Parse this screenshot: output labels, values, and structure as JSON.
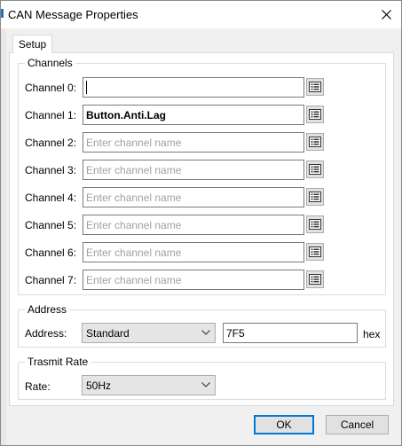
{
  "window": {
    "title": "CAN Message Properties"
  },
  "tabs": [
    {
      "label": "Setup"
    }
  ],
  "channels": {
    "legend": "Channels",
    "placeholder": "Enter channel name",
    "items": [
      {
        "label": "Channel 0:",
        "value": ""
      },
      {
        "label": "Channel 1:",
        "value": "Button.Anti.Lag"
      },
      {
        "label": "Channel 2:",
        "value": ""
      },
      {
        "label": "Channel 3:",
        "value": ""
      },
      {
        "label": "Channel 4:",
        "value": ""
      },
      {
        "label": "Channel 5:",
        "value": ""
      },
      {
        "label": "Channel 6:",
        "value": ""
      },
      {
        "label": "Channel 7:",
        "value": ""
      }
    ]
  },
  "address": {
    "legend": "Address",
    "label": "Address:",
    "type_selected": "Standard",
    "value": "7F5",
    "unit": "hex"
  },
  "transmit": {
    "legend": "Trasmit Rate",
    "label": "Rate:",
    "rate_selected": "50Hz"
  },
  "buttons": {
    "ok": "OK",
    "cancel": "Cancel"
  }
}
